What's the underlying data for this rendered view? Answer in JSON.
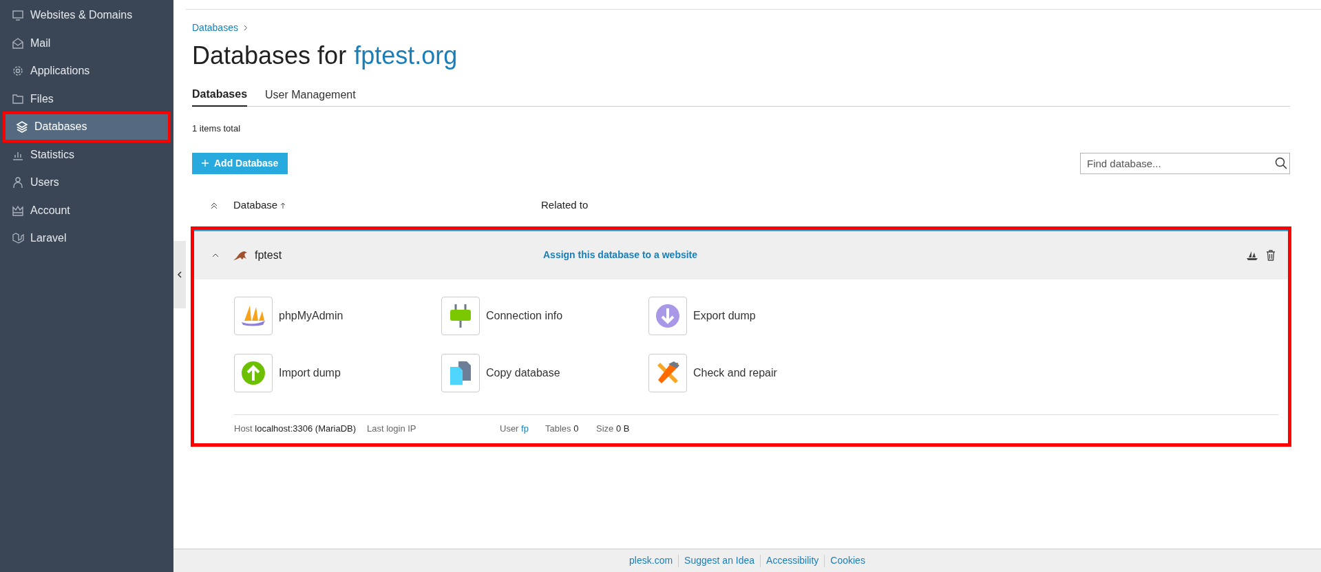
{
  "sidebar": {
    "items": [
      {
        "label": "Websites & Domains",
        "kind": "monitor",
        "selected": false
      },
      {
        "label": "Mail",
        "kind": "mail",
        "selected": false
      },
      {
        "label": "Applications",
        "kind": "gear",
        "selected": false
      },
      {
        "label": "Files",
        "kind": "folder",
        "selected": false
      },
      {
        "label": "Databases",
        "kind": "layers",
        "selected": true
      },
      {
        "label": "Statistics",
        "kind": "chart",
        "selected": false
      },
      {
        "label": "Users",
        "kind": "user",
        "selected": false
      },
      {
        "label": "Account",
        "kind": "crown",
        "selected": false
      },
      {
        "label": "Laravel",
        "kind": "laravel",
        "selected": false
      }
    ]
  },
  "breadcrumb": [
    "Databases"
  ],
  "title": {
    "prefix": "Databases for",
    "domain": "fptest.org"
  },
  "tabs": [
    {
      "label": "Databases",
      "selected": true
    },
    {
      "label": "User Management",
      "selected": false
    }
  ],
  "items_total": "1 items total",
  "add_button": "Add Database",
  "search": {
    "placeholder": "Find database..."
  },
  "table": {
    "columns": [
      "Database",
      "Related to"
    ],
    "rows": [
      {
        "name": "fptest",
        "expanded": true,
        "related_link": "Assign this database to a website",
        "tools": [
          {
            "label": "phpMyAdmin",
            "kind": "phpmyadmin"
          },
          {
            "label": "Connection info",
            "kind": "plug"
          },
          {
            "label": "Export dump",
            "kind": "export"
          },
          {
            "label": "Import dump",
            "kind": "import"
          },
          {
            "label": "Copy database",
            "kind": "copy"
          },
          {
            "label": "Check and repair",
            "kind": "repair"
          }
        ],
        "info": [
          {
            "label": "Host",
            "value": "localhost:3306 (MariaDB)",
            "kind": "text"
          },
          {
            "label": "Last login IP"
          },
          {
            "label": "User",
            "value": "fp",
            "kind": "link"
          },
          {
            "label": "Tables",
            "value": "0",
            "kind": "text"
          },
          {
            "label": "Size",
            "value": "0 B",
            "kind": "text"
          }
        ]
      }
    ]
  },
  "footer": [
    "plesk.com",
    "Suggest an Idea",
    "Accessibility",
    "Cookies"
  ]
}
